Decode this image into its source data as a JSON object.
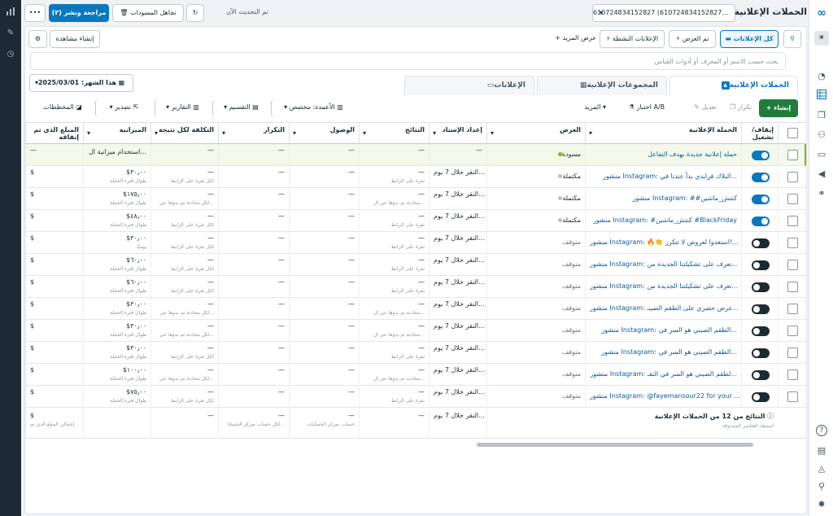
{
  "topbar": {
    "title": "الحملات الإعلانية",
    "account": "610724834152827 (610724834152827...",
    "updated": "تم التحديث الآن",
    "discard": "تجاهل المسودات",
    "review": "مراجعة ونشر (٣)",
    "more": "•••"
  },
  "filters": {
    "all": "كل الإعلانات",
    "shown": "تم العرض",
    "active": "الإعلانات النشطة",
    "more": "عرض المزيد",
    "create_view": "إنشاء مشاهدة"
  },
  "search": {
    "placeholder": "بحث حسب الاسم أو المعرف أو أدوات القياس"
  },
  "daterange": "هذا الشهر: 2025/03/01",
  "tabs": [
    "الحملات الإعلانية",
    "المجموعات الإعلانية",
    "الإعلانات"
  ],
  "toolbar": {
    "create": "إنشاء",
    "duplicate": "تكرار",
    "edit": "تعديل",
    "abtest": "اختبار A/B",
    "more": "المزيد",
    "columns": "الأعمدة: مخصص",
    "breakdown": "التقسيم",
    "reports": "التقارير",
    "export": "تصدير",
    "charts": "المخططات"
  },
  "columns": [
    "إيقاف/تشغيل",
    "الحملة الإعلانية",
    "العرض",
    "إعداد الإسناد",
    "النتائج",
    "الوصول",
    "التكرار",
    "التكلفة لكل نتيجة",
    "الميزانية",
    "المبلغ الذي تم إنفاقه"
  ],
  "rows": [
    {
      "on": true,
      "name": "حملة إعلانية جديدة بهدف التفاعل",
      "status": "مسودة",
      "status_color": "#8ab31c",
      "attr": "—",
      "results": "—",
      "results_sub": "",
      "reach": "—",
      "freq": "—",
      "cpr": "—",
      "cpr_sub": "",
      "budget": "استخدام ميزانية ال...",
      "budget_sub": "",
      "spent": "—"
    },
    {
      "on": true,
      "name": "منشور Instagram: البلاك فرايدي بدأ عندنا في...",
      "status": "مكتملة",
      "status_color": "#bcc0c4",
      "attr": "النقر خلال 7 يوم...",
      "results": "—",
      "results_sub": "نقرة على الرابط",
      "reach": "—",
      "freq": "—",
      "cpr": "—",
      "cpr_sub": "لكل نقرة على الرابط",
      "budget": "$٣٠٫٠٠",
      "budget_sub": "طوال فترة الحملة",
      "spent": "$"
    },
    {
      "on": true,
      "name": "منشور Instagram: ##كنتش_ماشين",
      "status": "مكتملة",
      "status_color": "#bcc0c4",
      "attr": "النقر خلال 7 يوم...",
      "results": "—",
      "results_sub": "محادثة تم بدؤها عبر ال...",
      "reach": "—",
      "freq": "—",
      "cpr": "—",
      "cpr_sub": "لكل محادثة تم بدؤها عبر...",
      "budget": "$١٧٥٫٠٠",
      "budget_sub": "طوال فترة الحملة",
      "spent": "$"
    },
    {
      "on": true,
      "name": "منشور Instagram: #كنتش_ماشين #BlackFriday",
      "status": "مكتملة",
      "status_color": "#bcc0c4",
      "attr": "النقر خلال 7 يوم...",
      "results": "—",
      "results_sub": "نقرة على الرابط",
      "reach": "—",
      "freq": "—",
      "cpr": "—",
      "cpr_sub": "لكل نقرة على الرابط",
      "budget": "$٤٨٫٠٠",
      "budget_sub": "طوال فترة الحملة",
      "spent": "$"
    },
    {
      "on": false,
      "name": "منشور Instagram: 🔥👏 استعدوا لعروض لا تتكرر!...",
      "status": "متوقف",
      "status_color": "",
      "attr": "النقر خلال 7 يوم...",
      "results": "—",
      "results_sub": "نقرة على الرابط",
      "reach": "—",
      "freq": "—",
      "cpr": "—",
      "cpr_sub": "لكل نقرة على الرابط",
      "budget": "$٣٠٫٠٠",
      "budget_sub": "يوميًا",
      "spent": "$"
    },
    {
      "on": false,
      "name": "منشور Instagram: تعرف على تشكيلتنا الجديدة من...",
      "status": "متوقف",
      "status_color": "",
      "attr": "النقر خلال 7 يوم...",
      "results": "—",
      "results_sub": "نقرة على الرابط",
      "reach": "—",
      "freq": "—",
      "cpr": "—",
      "cpr_sub": "لكل نقرة على الرابط",
      "budget": "$٦٠٫٠٠",
      "budget_sub": "طوال فترة الحملة",
      "spent": "$"
    },
    {
      "on": false,
      "name": "منشور Instagram: تعرف على تشكيلتنا الجديدة من...",
      "status": "متوقف",
      "status_color": "",
      "attr": "النقر خلال 7 يوم...",
      "results": "—",
      "results_sub": "نقرة على الرابط",
      "reach": "—",
      "freq": "—",
      "cpr": "—",
      "cpr_sub": "لكل نقرة على الرابط",
      "budget": "$٦٠٫٠٠",
      "budget_sub": "طوال فترة الحملة",
      "spent": "$"
    },
    {
      "on": false,
      "name": "منشور Instagram: عرض حصري على الطقم الصينـ...",
      "status": "متوقف",
      "status_color": "",
      "attr": "النقر خلال 7 يوم...",
      "results": "—",
      "results_sub": "محادثة تم بدؤها عبر ال...",
      "reach": "—",
      "freq": "—",
      "cpr": "—",
      "cpr_sub": "لكل محادثة تم بدؤها عبر...",
      "budget": "$٣٠٫٠٠",
      "budget_sub": "طوال فترة الحملة",
      "spent": "$"
    },
    {
      "on": false,
      "name": "منشور Instagram: الطقم الصيني هو السر في...",
      "status": "متوقف",
      "status_color": "",
      "attr": "النقر خلال 7 يوم...",
      "results": "—",
      "results_sub": "محادثة تم بدؤها عبر ال...",
      "reach": "—",
      "freq": "—",
      "cpr": "—",
      "cpr_sub": "لكل محادثة تم بدؤها عبر...",
      "budget": "$٣٠٫٠٠",
      "budget_sub": "طوال فترة الحملة",
      "spent": "$"
    },
    {
      "on": false,
      "name": "منشور Instagram: الطقم الصيني هو السر في...",
      "status": "متوقف",
      "status_color": "",
      "attr": "النقر خلال 7 يوم...",
      "results": "—",
      "results_sub": "نقرة على الرابط",
      "reach": "—",
      "freq": "—",
      "cpr": "—",
      "cpr_sub": "لكل نقرة على الرابط",
      "budget": "$٣٠٫٠٠",
      "budget_sub": "طوال فترة الحملة",
      "spent": "$"
    },
    {
      "on": false,
      "name": "منشور Instagram: لطقم الصيني هو السر في التقـ...",
      "status": "متوقف",
      "status_color": "",
      "attr": "النقر خلال 7 يوم...",
      "results": "—",
      "results_sub": "محادثة تم بدؤها عبر ال...",
      "reach": "—",
      "freq": "—",
      "cpr": "—",
      "cpr_sub": "لكل محادثة تم بدؤها عبر...",
      "budget": "$١٠٠٫٠٠",
      "budget_sub": "طوال فترة الحملة",
      "spent": "$"
    },
    {
      "on": false,
      "name": "منشور Instagram: @fayemansour22 for your ...ks",
      "status": "متوقف",
      "status_color": "",
      "attr": "النقر خلال 7 يوم...",
      "results": "—",
      "results_sub": "نقرة على الرابط",
      "reach": "—",
      "freq": "—",
      "cpr": "—",
      "cpr_sub": "لكل نقرة على الرابط",
      "budget": "$٧٥٫٠٠",
      "budget_sub": "طوال فترة الحملة",
      "spent": "$"
    }
  ],
  "footer": {
    "summary": "النتائج من 12 من الحملات الإعلانية",
    "excluded": "استبعاد العناصر المحذوفة",
    "attr": "النقر خلال 7 يوم...",
    "results": "—",
    "reach": "—",
    "reach_sub": "حساب بمركز الحسابات",
    "freq": "—",
    "freq_sub": "لكل حساب بمركز الحسابا...",
    "cpr": "—",
    "budget": "",
    "spent": "$",
    "spent_sub": "إجمالي المبلغ الذي تم"
  },
  "colors": {
    "primary": "#0a78be",
    "create": "#217c3c",
    "rail": "#1c2b33"
  }
}
